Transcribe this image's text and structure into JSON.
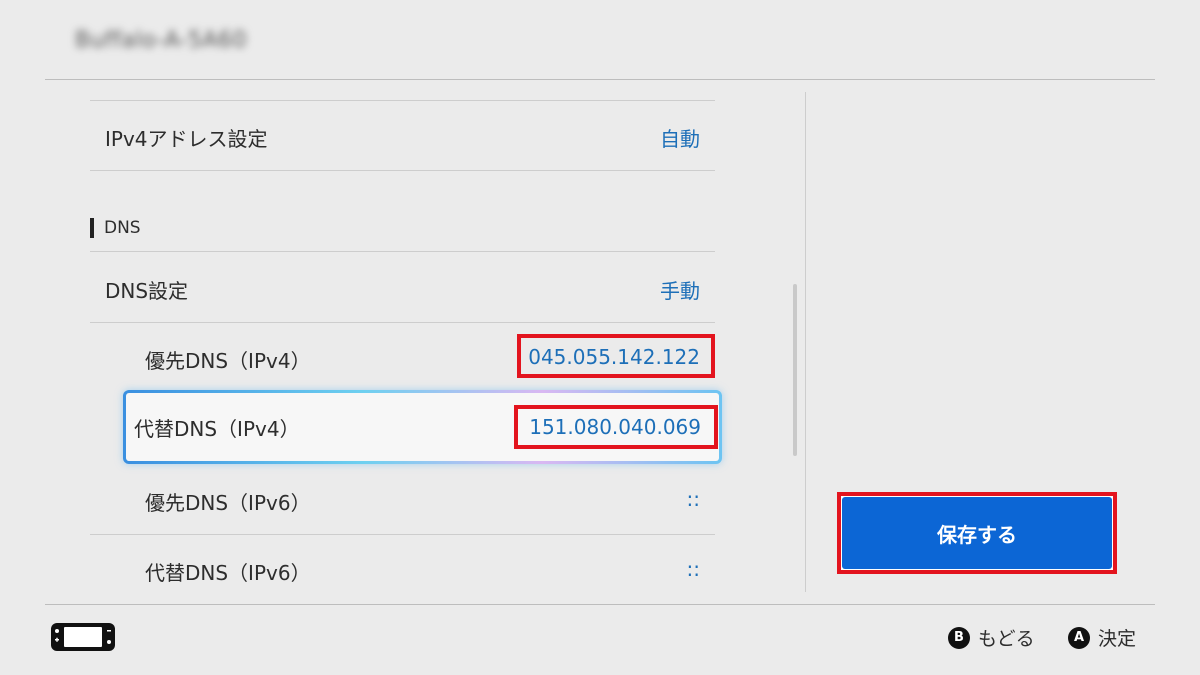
{
  "header": {
    "title": "Buffalo-A-5A60"
  },
  "ipv4": {
    "label": "IPv4アドレス設定",
    "value": "自動"
  },
  "dns_section": {
    "label": "DNS"
  },
  "dns_setting": {
    "label": "DNS設定",
    "value": "手動"
  },
  "dns_entries": [
    {
      "label": "優先DNS（IPv4）",
      "value": "045.055.142.122"
    },
    {
      "label": "代替DNS（IPv4）",
      "value": "151.080.040.069"
    },
    {
      "label": "優先DNS（IPv6）",
      "value": "::"
    },
    {
      "label": "代替DNS（IPv6）",
      "value": "::"
    }
  ],
  "save_button": {
    "label": "保存する"
  },
  "footer": {
    "back": {
      "key": "B",
      "label": "もどる"
    },
    "confirm": {
      "key": "A",
      "label": "決定"
    }
  },
  "colors": {
    "accent": "#0c66d5",
    "value_text": "#1d6fb8",
    "highlight_red": "#e3141e",
    "background": "#ebebeb"
  },
  "icons": {
    "console": "console-icon"
  }
}
